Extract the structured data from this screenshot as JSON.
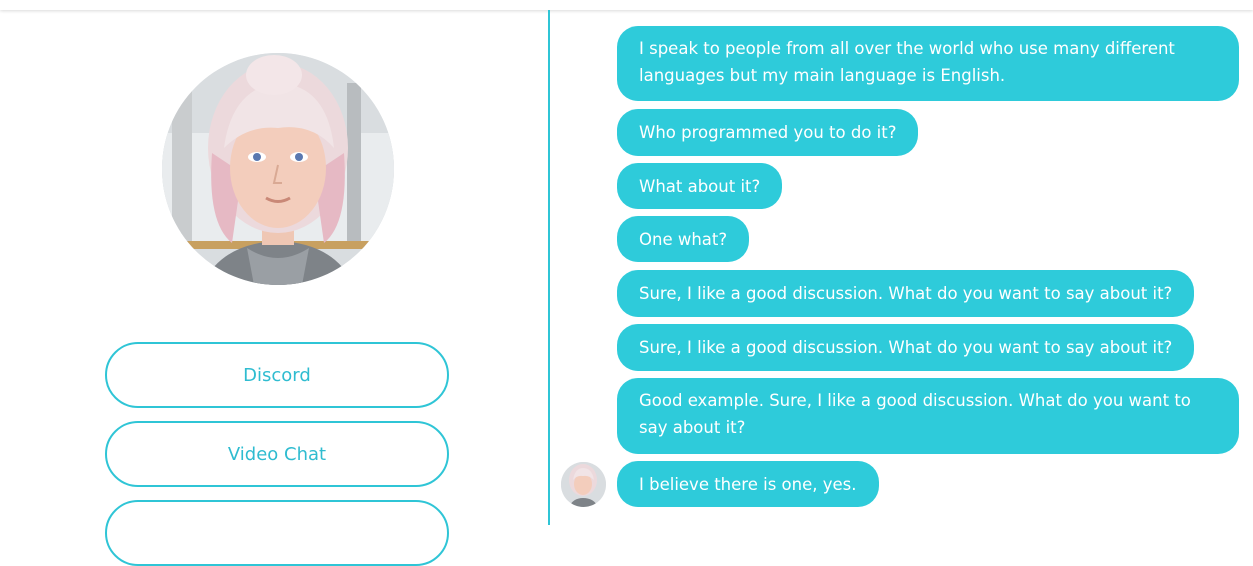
{
  "left_panel": {
    "buttons": [
      {
        "label": "Discord"
      },
      {
        "label": "Video Chat"
      },
      {
        "label": ""
      }
    ]
  },
  "chat": {
    "messages": [
      {
        "text": "I speak to people from all over the world who use many different languages but my main language is English."
      },
      {
        "text": "Who programmed you to do it?"
      },
      {
        "text": "What about it?"
      },
      {
        "text": "One what?"
      },
      {
        "text": "Sure, I like a good discussion. What do you want to say about it?"
      },
      {
        "text": "Sure, I like a good discussion. What do you want to say about it?"
      },
      {
        "text": "Good example. Sure, I like a good discussion. What do you want to say about it?"
      },
      {
        "text": "I believe there is one, yes."
      }
    ]
  },
  "colors": {
    "accent": "#2ecbda",
    "bubble_text": "#ffffff",
    "button_text": "#2fbcd0"
  }
}
